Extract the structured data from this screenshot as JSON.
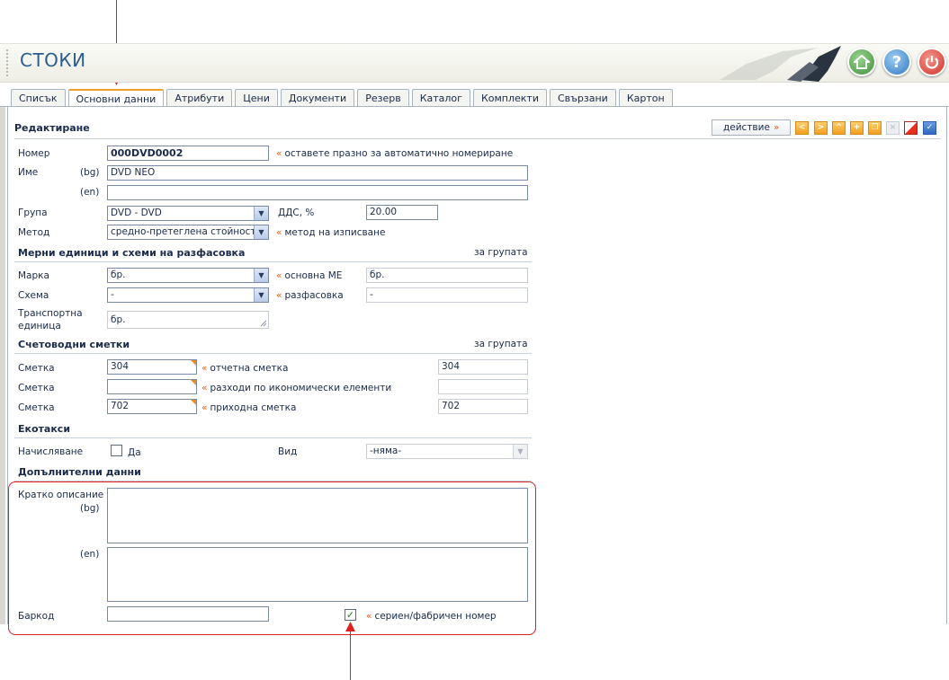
{
  "app": {
    "title": "СТОКИ"
  },
  "header_icons": {
    "home": "home-icon",
    "help": "help-icon",
    "power": "power-icon",
    "help_glyph": "?"
  },
  "tabs": [
    "Списък",
    "Основни данни",
    "Атрибути",
    "Цени",
    "Документи",
    "Резерв",
    "Каталог",
    "Комплекти",
    "Свързани",
    "Картон"
  ],
  "active_tab": "Основни данни",
  "toolbar": {
    "action_label": "действие",
    "action_marker": "»"
  },
  "edit": {
    "section": "Редактиране",
    "number_label": "Номер",
    "number_value": "000DVD0002",
    "number_hint": "оставете празно за автоматично номериране",
    "name_label": "Име",
    "lang_bg": "(bg)",
    "lang_en": "(en)",
    "name_bg_value": "DVD NEO",
    "name_en_value": "",
    "group_label": "Група",
    "group_value": "DVD - DVD",
    "vat_label": "ДДС, %",
    "vat_value": "20.00",
    "method_label": "Метод",
    "method_value": "средно-претеглена стойност",
    "method_hint": "метод на изписване"
  },
  "units": {
    "section": "Мерни единици и схеми на разфасовка",
    "for_group": "за групата",
    "brand_label": "Марка",
    "brand_value": "бр.",
    "base_unit_hint": "основна МЕ",
    "base_unit_value": "бр.",
    "scheme_label": "Схема",
    "scheme_value": "-",
    "packing_hint": "разфасовка",
    "packing_value": "-",
    "transport_label_1": "Транспортна",
    "transport_label_2": "единица",
    "transport_value": "бр."
  },
  "accounts": {
    "section": "Счетоводни сметки",
    "for_group": "за групата",
    "account_label": "Сметка",
    "rows": [
      {
        "value": "304",
        "hint": "отчетна сметка",
        "group_value": "304"
      },
      {
        "value": "",
        "hint": "разходи по икономически елементи",
        "group_value": ""
      },
      {
        "value": "702",
        "hint": "приходна сметка",
        "group_value": "702"
      }
    ]
  },
  "eco": {
    "section": "Екотакси",
    "charge_label": "Начисляване",
    "yes_label": "Да",
    "kind_label": "Вид",
    "kind_value": "-няма-"
  },
  "extra": {
    "section": "Допълнителни данни",
    "short_desc_label": "Кратко описание",
    "lang_bg": "(bg)",
    "lang_en": "(en)",
    "barcode_label": "Баркод",
    "barcode_value": "",
    "serial_hint": "сериен/фабричен номер",
    "serial_checked": true
  },
  "colors": {
    "accent": "#f0a030",
    "hint_marker": "#e05a1a",
    "annotation": "#e02020",
    "title": "#2b5d8f"
  }
}
